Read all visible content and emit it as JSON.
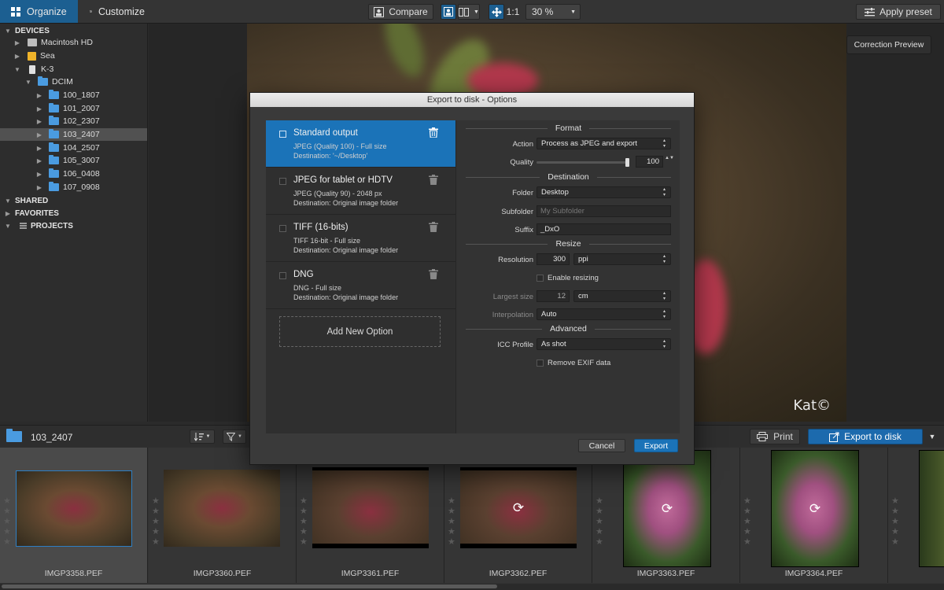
{
  "toolbar": {
    "organize_label": "Organize",
    "customize_label": "Customize",
    "compare_label": "Compare",
    "zoom_1to1": "1:1",
    "zoom_value": "30 %",
    "apply_preset_label": "Apply preset"
  },
  "tree": {
    "devices": "DEVICES",
    "shared": "SHARED",
    "favorites": "FAVORITES",
    "projects": "PROJECTS",
    "items": [
      {
        "label": "Macintosh HD"
      },
      {
        "label": "Sea"
      },
      {
        "label": "K-3"
      },
      {
        "label": "DCIM"
      },
      {
        "label": "100_1807"
      },
      {
        "label": "101_2007"
      },
      {
        "label": "102_2307"
      },
      {
        "label": "103_2407"
      },
      {
        "label": "104_2507"
      },
      {
        "label": "105_3007"
      },
      {
        "label": "106_0408"
      },
      {
        "label": "107_0908"
      }
    ]
  },
  "viewer": {
    "correction_preview": "Correction Preview",
    "watermark": "Kat©"
  },
  "filmstrip": {
    "folder_name": "103_2407",
    "print_label": "Print",
    "export_label": "Export to disk",
    "files": [
      "IMGP3358.PEF",
      "IMGP3360.PEF",
      "IMGP3361.PEF",
      "IMGP3362.PEF",
      "IMGP3363.PEF",
      "IMGP3364.PEF"
    ]
  },
  "dialog": {
    "title": "Export to disk - Options",
    "options": [
      {
        "title": "Standard output",
        "line1": "JPEG (Quality 100) - Full size",
        "line2": "Destination: '~/Desktop'"
      },
      {
        "title": "JPEG for tablet or HDTV",
        "line1": "JPEG (Quality 90) - 2048 px",
        "line2": "Destination: Original image folder"
      },
      {
        "title": "TIFF (16-bits)",
        "line1": "TIFF 16-bit - Full size",
        "line2": "Destination: Original image folder"
      },
      {
        "title": "DNG",
        "line1": "DNG - Full size",
        "line2": "Destination: Original image folder"
      }
    ],
    "add_option": "Add New Option",
    "sections": {
      "format": "Format",
      "destination": "Destination",
      "resize": "Resize",
      "advanced": "Advanced"
    },
    "fields": {
      "action_label": "Action",
      "action_value": "Process as JPEG and export",
      "quality_label": "Quality",
      "quality_value": "100",
      "folder_label": "Folder",
      "folder_value": "Desktop",
      "subfolder_label": "Subfolder",
      "subfolder_placeholder": "My Subfolder",
      "suffix_label": "Suffix",
      "suffix_value": "_DxO",
      "resolution_label": "Resolution",
      "resolution_value": "300",
      "resolution_unit": "ppi",
      "enable_resizing": "Enable resizing",
      "largest_size_label": "Largest size",
      "largest_size_value": "12",
      "largest_size_unit": "cm",
      "interpolation_label": "Interpolation",
      "interpolation_value": "Auto",
      "icc_label": "ICC Profile",
      "icc_value": "As shot",
      "remove_exif": "Remove EXIF data"
    },
    "cancel": "Cancel",
    "export": "Export"
  },
  "colors": {
    "accent": "#1b73b8",
    "toolbar_active": "#1c5f91",
    "folder_icon": "#4a9be0"
  }
}
